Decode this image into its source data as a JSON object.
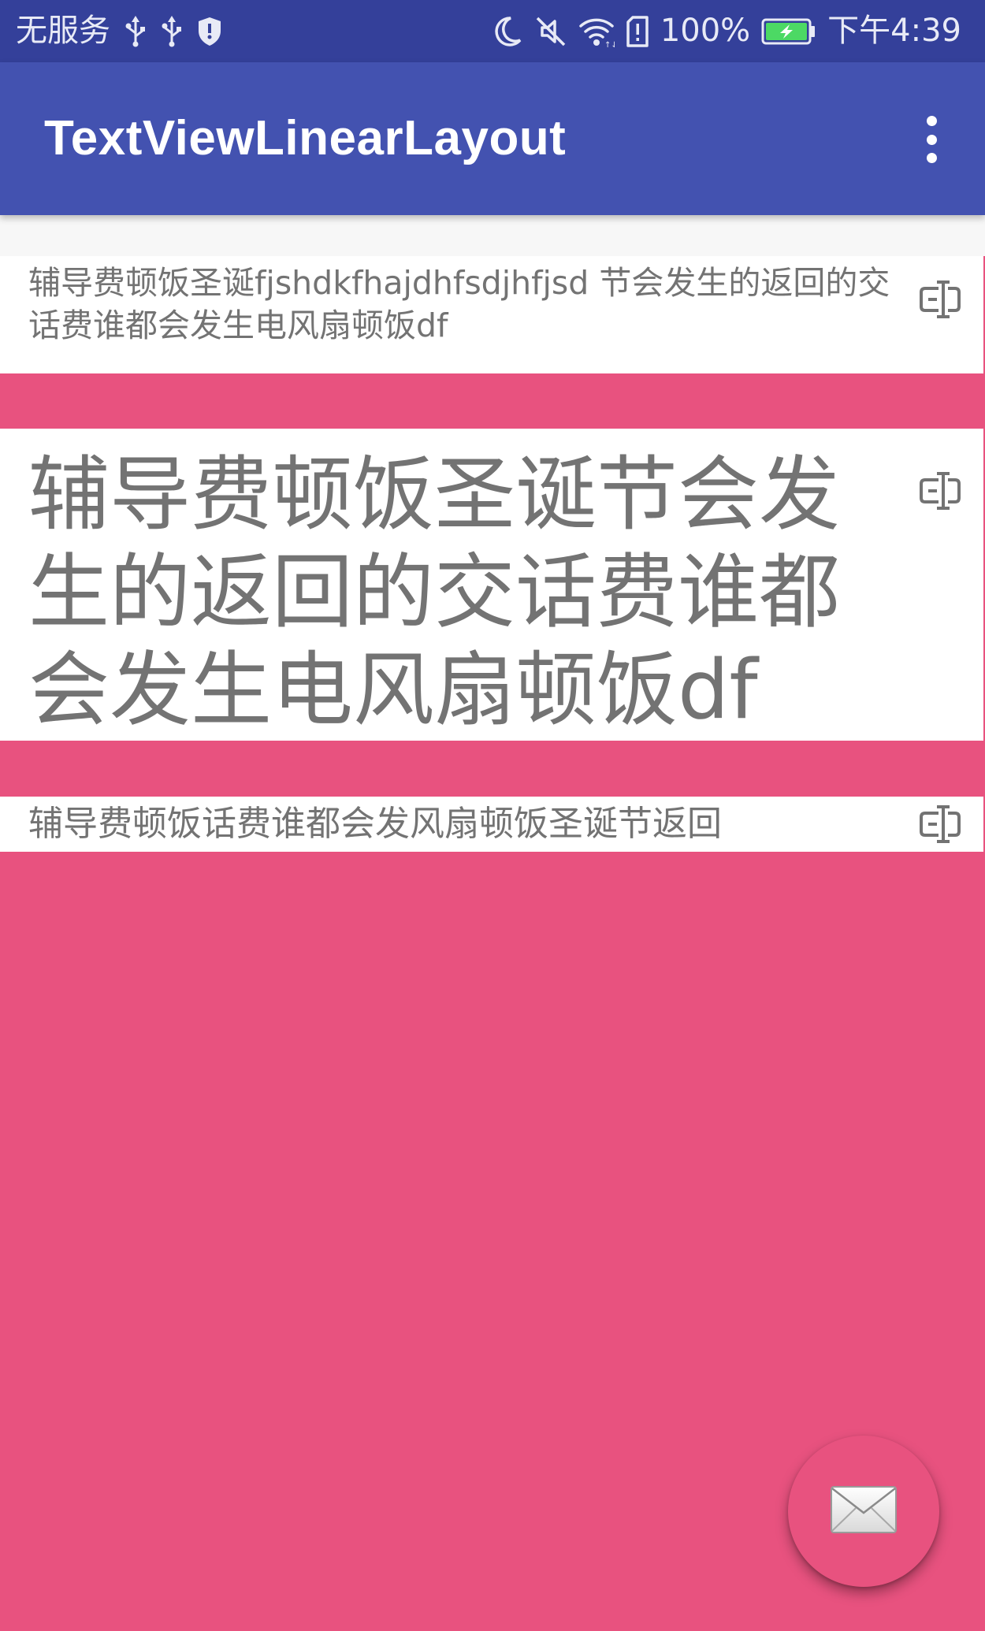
{
  "status_bar": {
    "carrier": "无服务",
    "battery_percent": "100%",
    "time": "下午4:39",
    "left_icons": [
      "usb-icon",
      "usb-icon",
      "shield-icon"
    ],
    "right_icons": [
      "moon-icon",
      "mute-icon",
      "wifi-icon",
      "sim-alert-icon",
      "battery-charging-icon"
    ],
    "battery_color": "#4CD964"
  },
  "app_bar": {
    "title": "TextViewLinearLayout",
    "menu_icon": "overflow-menu-icon",
    "background_color": "#4352B0"
  },
  "main": {
    "background_color": "#E8527F",
    "text_rows": [
      {
        "text": "辅导费顿饭圣诞fjshdkfhajdhfsdjhfjsd 节会发生的返回的交话费谁都会发生电风扇顿饭df",
        "icon": "text-edit-icon"
      },
      {
        "text": "辅导费顿饭圣诞节会发生的返回的交话费谁都会发生电风扇顿饭df",
        "icon": "text-edit-icon"
      },
      {
        "text": "辅导费顿饭话费谁都会发风扇顿饭圣诞节返回",
        "icon": "text-edit-icon"
      }
    ]
  },
  "fab": {
    "icon": "email-icon",
    "color": "#E8527F"
  }
}
